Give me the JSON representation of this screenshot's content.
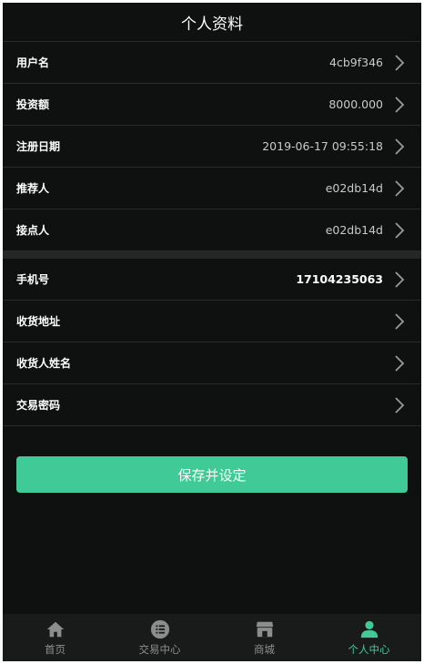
{
  "header": {
    "title": "个人资料"
  },
  "profile_rows": [
    {
      "label": "用户名",
      "value": "4cb9f346"
    },
    {
      "label": "投资额",
      "value": "8000.000"
    },
    {
      "label": "注册日期",
      "value": "2019-06-17 09:55:18"
    },
    {
      "label": "推荐人",
      "value": "e02db14d"
    },
    {
      "label": "接点人",
      "value": "e02db14d"
    }
  ],
  "detail_rows": [
    {
      "label": "手机号",
      "value": "17104235063"
    },
    {
      "label": "收货地址",
      "value": ""
    },
    {
      "label": "收货人姓名",
      "value": ""
    },
    {
      "label": "交易密码",
      "value": ""
    }
  ],
  "save_button": {
    "label": "保存并设定"
  },
  "tabbar": {
    "tabs": [
      {
        "label": "首页",
        "icon": "home-icon"
      },
      {
        "label": "交易中心",
        "icon": "list-icon"
      },
      {
        "label": "商城",
        "icon": "store-icon"
      },
      {
        "label": "个人中心",
        "icon": "user-icon"
      }
    ],
    "active_index": 3
  },
  "colors": {
    "accent": "#3fca97",
    "background": "#0f1111",
    "tabbar": "#191b1b"
  }
}
